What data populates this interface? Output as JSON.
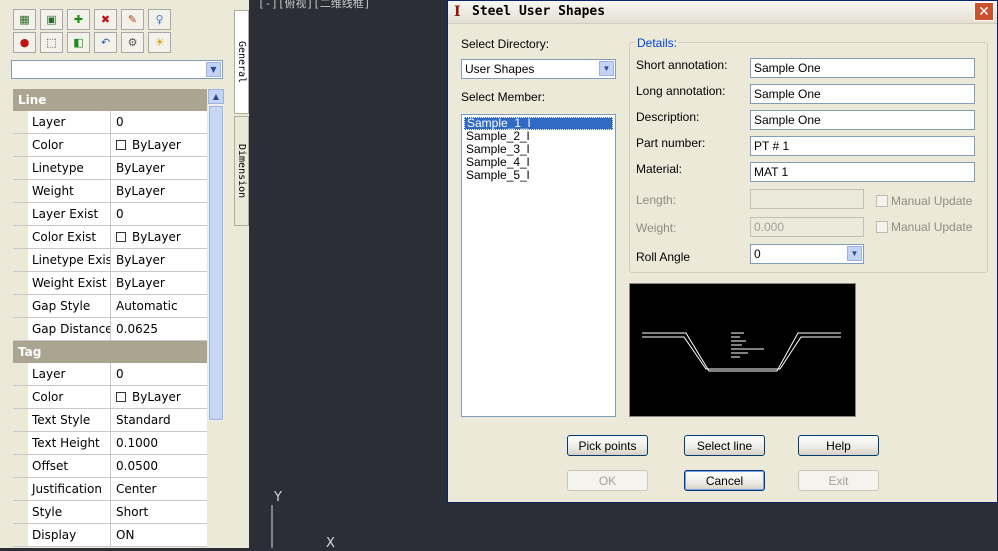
{
  "palette": {
    "combo_value": "",
    "tabs": [
      "General",
      "Dimension"
    ],
    "sections": [
      {
        "title": "Line",
        "rows": [
          {
            "name": "Layer",
            "value": "0",
            "check": false
          },
          {
            "name": "Color",
            "value": "ByLayer",
            "check": true
          },
          {
            "name": "Linetype",
            "value": "ByLayer",
            "check": false
          },
          {
            "name": "Weight",
            "value": "ByLayer",
            "check": false
          },
          {
            "name": "Layer Exist",
            "value": "0",
            "check": false
          },
          {
            "name": "Color Exist",
            "value": "ByLayer",
            "check": true
          },
          {
            "name": "Linetype Exist",
            "value": "ByLayer",
            "check": false
          },
          {
            "name": "Weight Exist",
            "value": "ByLayer",
            "check": false
          },
          {
            "name": "Gap Style",
            "value": "Automatic",
            "check": false
          },
          {
            "name": "Gap Distance",
            "value": "0.0625",
            "check": false
          }
        ]
      },
      {
        "title": "Tag",
        "rows": [
          {
            "name": "Layer",
            "value": "0",
            "check": false
          },
          {
            "name": "Color",
            "value": "ByLayer",
            "check": true
          },
          {
            "name": "Text Style",
            "value": "Standard",
            "check": false
          },
          {
            "name": "Text Height",
            "value": "0.1000",
            "check": false
          },
          {
            "name": "Offset",
            "value": "0.0500",
            "check": false
          },
          {
            "name": "Justification",
            "value": "Center",
            "check": false
          },
          {
            "name": "Style",
            "value": "Short",
            "check": false
          },
          {
            "name": "Display",
            "value": "ON",
            "check": false
          }
        ]
      }
    ]
  },
  "drawing": {
    "top_label": "[-][俯视][二维线框]",
    "ucs_y": "Y",
    "ucs_x": "X"
  },
  "dialog": {
    "title": "Steel User Shapes",
    "close_label": "✕",
    "select_directory_label": "Select Directory:",
    "directory_value": "User Shapes",
    "select_member_label": "Select Member:",
    "members": [
      "Sample_1_l",
      "Sample_2_l",
      "Sample_3_l",
      "Sample_4_l",
      "Sample_5_l"
    ],
    "selected_member": "Sample_1_l",
    "details_label": "Details:",
    "short_annotation_label": "Short annotation:",
    "short_annotation_value": "Sample One",
    "long_annotation_label": "Long annotation:",
    "long_annotation_value": "Sample One",
    "description_label": "Description:",
    "description_value": "Sample One",
    "part_number_label": "Part number:",
    "part_number_value": "PT # 1",
    "material_label": "Material:",
    "material_value": "MAT 1",
    "length_label": "Length:",
    "length_value": "",
    "weight_label": "Weight:",
    "weight_value": "0.000",
    "manual_update_label": "Manual Update",
    "roll_angle_label": "Roll Angle",
    "roll_angle_value": "0",
    "buttons": {
      "pick_points": "Pick points",
      "select_line": "Select line",
      "help": "Help",
      "ok": "OK",
      "cancel": "Cancel",
      "exit": "Exit"
    }
  }
}
